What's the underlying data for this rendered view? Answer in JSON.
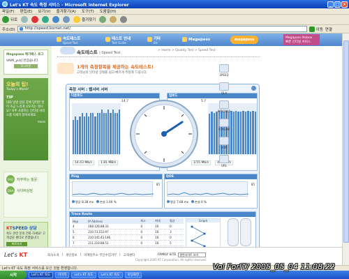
{
  "window": {
    "title": "Let's KT 속도 측정 서비스 - Microsoft Internet Explorer"
  },
  "menubar": [
    "파일(F)",
    "편집(E)",
    "보기(V)",
    "즐겨찾기(A)",
    "도구(T)",
    "도움말(H)"
  ],
  "toolbar": {
    "back": "뒤로",
    "favorites": "즐겨찾기"
  },
  "address": {
    "label": "주소(D)",
    "value": "http://speed.kornet.net/",
    "go": "이동",
    "links": "연결"
  },
  "site_nav": {
    "items": [
      {
        "label": "속도테스트",
        "sub": "Speed Test"
      },
      {
        "label": "테스트 안내",
        "sub": "Test Guide"
      },
      {
        "label": "기타",
        "sub": "Etc"
      },
      {
        "label": "Megapass",
        "sub": ""
      }
    ],
    "badge": "megapass",
    "promo_title": "Megapass Nobox",
    "promo_sub": "빠른 인터넷 서비스"
  },
  "left": {
    "mega_logo": "Megapass 메가패스 로그",
    "welcome": "VAIM_yu님 반갑습니다.",
    "logout": "로그아웃",
    "today_title": "오늘의 팁!",
    "today_sub": "Today's Word!",
    "tip_label": "TIP",
    "tip_text": "대화 방법 상담 창에 입력한 말이 조금 느리게 나오지는 않나요? 자주 사용하는 인터넷 서비스를 자세히 알아보세요.",
    "tip_more": "more",
    "faq": [
      {
        "badge": "FAQ",
        "label": "자주하는 질문"
      },
      {
        "badge": "Q&A",
        "label": "사이버상담"
      }
    ],
    "kt_title_kt": "KT",
    "kt_title_rest": "SPEED 상담",
    "kt_text": "속도 관련 문의 전화 하세요! 고객상담 센터로 연결됩니다.",
    "kt_btn": "바로가기"
  },
  "main": {
    "page_title": "속도테스트",
    "page_title_en": "| Speed Test",
    "breadcrumb": "> Home > Quality Test > Speed Test",
    "slogan1": "1개의 측정항목을 제공하는 속도테스트!",
    "slogan2": "고객님의 인터넷 상태를 쉽고 빠르게 측정해 드립니다.",
    "panel_head": "측정 서버 : 웹서버 서버",
    "download": {
      "head": "다운로드",
      "max": "14.7",
      "rate1": "14.43 Mb/s",
      "rate2": "1.81 MB/s"
    },
    "upload": {
      "head": "업로드",
      "max": "5.7",
      "rate1": "3.55 Mb/s",
      "rate2": "444 KB/s"
    },
    "ping": {
      "head": "Ping",
      "max": "85",
      "r1_label": "평균",
      "r1": "8.38 ms",
      "r2_label": "손실",
      "r2": "1.00 %"
    },
    "qos": {
      "head": "QOS",
      "max": "85",
      "r1_label": "평균",
      "r1": "7.68 ms",
      "r2_label": "손실",
      "r2": "0 %"
    },
    "trace": {
      "head": "Trace Route",
      "columns": [
        "Hop",
        "IP Address",
        "최소",
        "최대",
        "평균",
        "Graph"
      ],
      "rows": [
        [
          "4",
          "168.126.88.33",
          "0",
          "16",
          "0"
        ],
        [
          "5",
          "210.73.152.97",
          "0",
          "16",
          "3"
        ],
        [
          "6",
          "210.145.43.146",
          "0",
          "16",
          "0"
        ],
        [
          "7",
          "211.216.88.51",
          "0",
          "16",
          "5"
        ]
      ],
      "gauge1": "CPU",
      "gauge2": "Memory"
    },
    "btn_retest": "다시측정하기",
    "btn_result": "측정결과"
  },
  "right": [
    "SPEED",
    "QLA",
    "WIN2000",
    "STREAM",
    "VOIP",
    "URL"
  ],
  "footer": {
    "logo_lets": "Let's",
    "logo_kt": "KT",
    "links": [
      "회사소개",
      "개인정보",
      "이메일주소 무단수집거부",
      "고객센터"
    ],
    "family_label": "FAMILY SITE",
    "family_select": "관련사이트 보기",
    "copyright": "Copyright 2005 KT Corporation. All rights reserved."
  },
  "statusbar": "Let's KT 속도 측정 서비스를 오신 것을 환영합니다.",
  "taskbar": {
    "start": "시작",
    "tasks": [
      "Let's KT 속도",
      "이미지",
      "Let's KT 속도",
      "Let's KT 속도",
      "바탕화면"
    ]
  },
  "watermark": "Vol ForIT/ 2005_05_04 11:08:22",
  "chart_data": [
    {
      "type": "bar",
      "title": "다운로드",
      "values": [
        10,
        11,
        10,
        11,
        12,
        11,
        12,
        11,
        12,
        12,
        11,
        12,
        12,
        13,
        12,
        12,
        13,
        12,
        13,
        12,
        12,
        13
      ],
      "ylim": [
        0,
        14.7
      ]
    },
    {
      "type": "bar",
      "title": "업로드",
      "values": [
        4.6,
        4.8,
        4.7,
        4.8,
        4.9,
        4.8,
        4.8,
        4.9,
        4.8,
        4.9,
        4.8,
        4.9,
        4.8,
        4.8,
        4.9,
        4.8,
        4.9,
        4.8,
        4.9,
        4.8
      ],
      "ylim": [
        0,
        5.7
      ]
    }
  ]
}
